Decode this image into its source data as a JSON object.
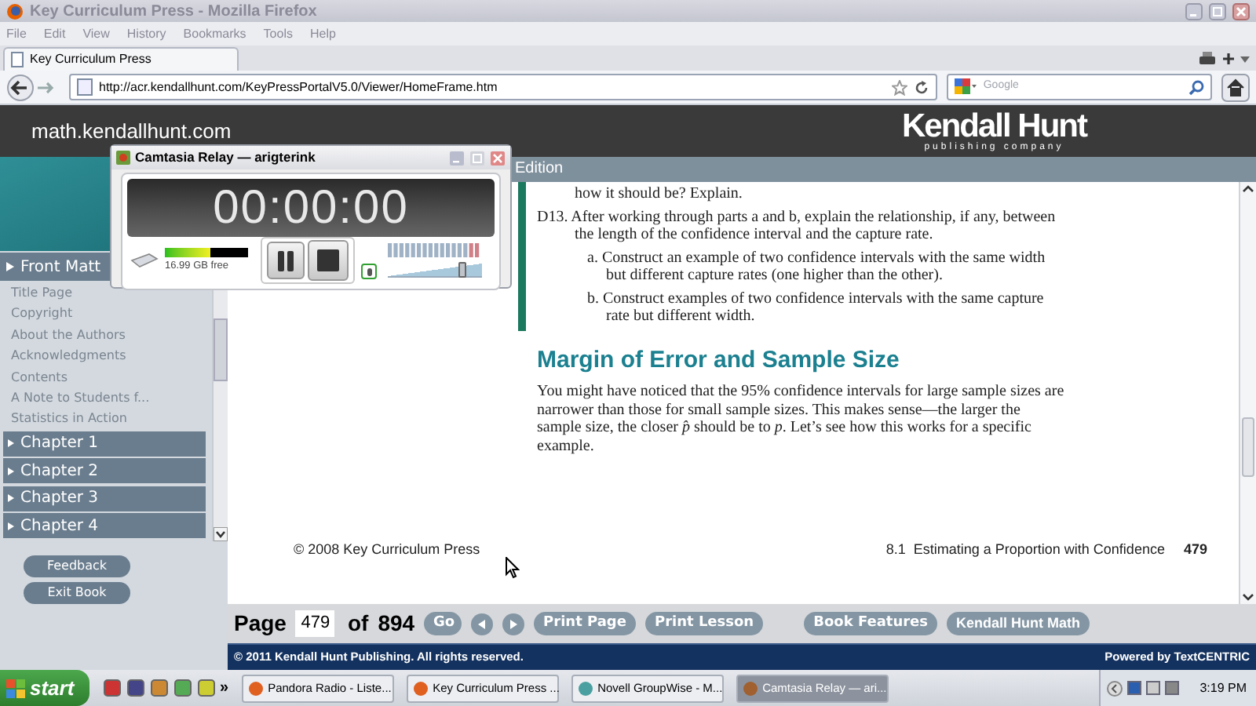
{
  "window": {
    "title": "Key Curriculum Press - Mozilla Firefox"
  },
  "menu": [
    "File",
    "Edit",
    "View",
    "History",
    "Bookmarks",
    "Tools",
    "Help"
  ],
  "tabs": [
    {
      "label": "Key Curriculum Press",
      "selected": true
    }
  ],
  "address_bar": {
    "value": "http://acr.kendallhunt.com/KeyPressPortalV5.0/Viewer/HomeFrame.htm"
  },
  "search": {
    "placeholder": "Google"
  },
  "site_header": {
    "url": "math.kendallhunt.com",
    "logo": "Kendall Hunt",
    "logo_sub": "publishing company"
  },
  "sidebar": {
    "section": {
      "label": "Front Matt",
      "expanded": true
    },
    "items": [
      "Title Page",
      "Copyright",
      "About the Authors",
      "Acknowledgments",
      "Contents",
      "A Note to Students f...",
      "Statistics in Action"
    ],
    "chapters": [
      "Chapter 1",
      "Chapter 2",
      "Chapter 3",
      "Chapter 4"
    ],
    "buttons": [
      "Feedback",
      "Exit Book"
    ]
  },
  "book_header": "Edition",
  "page": {
    "lines": [
      {
        "kind": "cont",
        "text": "how it should be? Explain."
      },
      {
        "kind": "item",
        "marker": "D13.",
        "text": "After working through parts a and b, explain the relationship, if any, between the length of the confidence interval and the capture rate."
      },
      {
        "kind": "sub",
        "marker": "a.",
        "text": "Construct an example of two confidence intervals with the same width but different capture rates (one higher than the other)."
      },
      {
        "kind": "sub",
        "marker": "b.",
        "text": "Construct examples of two confidence intervals with the same capture rate but different width."
      }
    ],
    "heading": "Margin of Error and Sample Size",
    "paragraph": "You might have noticed that the 95% confidence intervals for large sample sizes are narrower than those for small sample sizes. This makes sense—the larger the sample size, the closer *p̂* should be to *p*. Let’s see how this works for a specific example.",
    "footer_left": "© 2008 Key Curriculum Press",
    "footer_section": "8.1  Estimating a Proportion with Confidence",
    "footer_page": "479"
  },
  "page_nav": {
    "label": "Page",
    "value": "479",
    "of": "of",
    "total": "894",
    "go": "Go",
    "buttons": [
      "Print Page",
      "Print Lesson",
      "Book Features",
      "Kendall Hunt Math"
    ]
  },
  "footer": {
    "left": "© 2011 Kendall Hunt Publishing. All rights reserved.",
    "right": "Powered by TextCENTRIC"
  },
  "recorder": {
    "title": "Camtasia Relay — arigterink",
    "timer": "00:00:00",
    "disk": {
      "level": 0.55,
      "free": "16.99 GB free"
    },
    "volume": {
      "level": 0.8
    }
  },
  "taskbar": {
    "start": "start",
    "chevron": "»",
    "tasks": [
      {
        "label": "Pandora Radio - Liste...",
        "selected": false
      },
      {
        "label": "Key Curriculum Press ...",
        "selected": false
      },
      {
        "label": "Novell GroupWise - M...",
        "selected": false
      },
      {
        "label": "Camtasia Relay — ari...",
        "selected": true
      }
    ],
    "clock": "3:19 PM"
  }
}
